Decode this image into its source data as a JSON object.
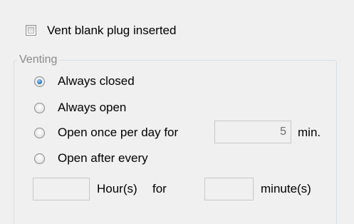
{
  "vent_blank_plug": {
    "label": "Vent blank plug inserted",
    "checked": false
  },
  "venting": {
    "group_label": "Venting",
    "options": [
      {
        "label": "Always closed",
        "selected": true
      },
      {
        "label": "Always open",
        "selected": false
      },
      {
        "label": "Open once per day for",
        "selected": false
      },
      {
        "label": "Open after every",
        "selected": false
      }
    ],
    "once_per_day_minutes_value": "5",
    "minutes_unit_label": "min.",
    "after_every_hours_value": "",
    "hours_label": "Hour(s)",
    "for_label": "for",
    "after_every_minutes_value": "",
    "minutes_label": "minute(s)"
  }
}
